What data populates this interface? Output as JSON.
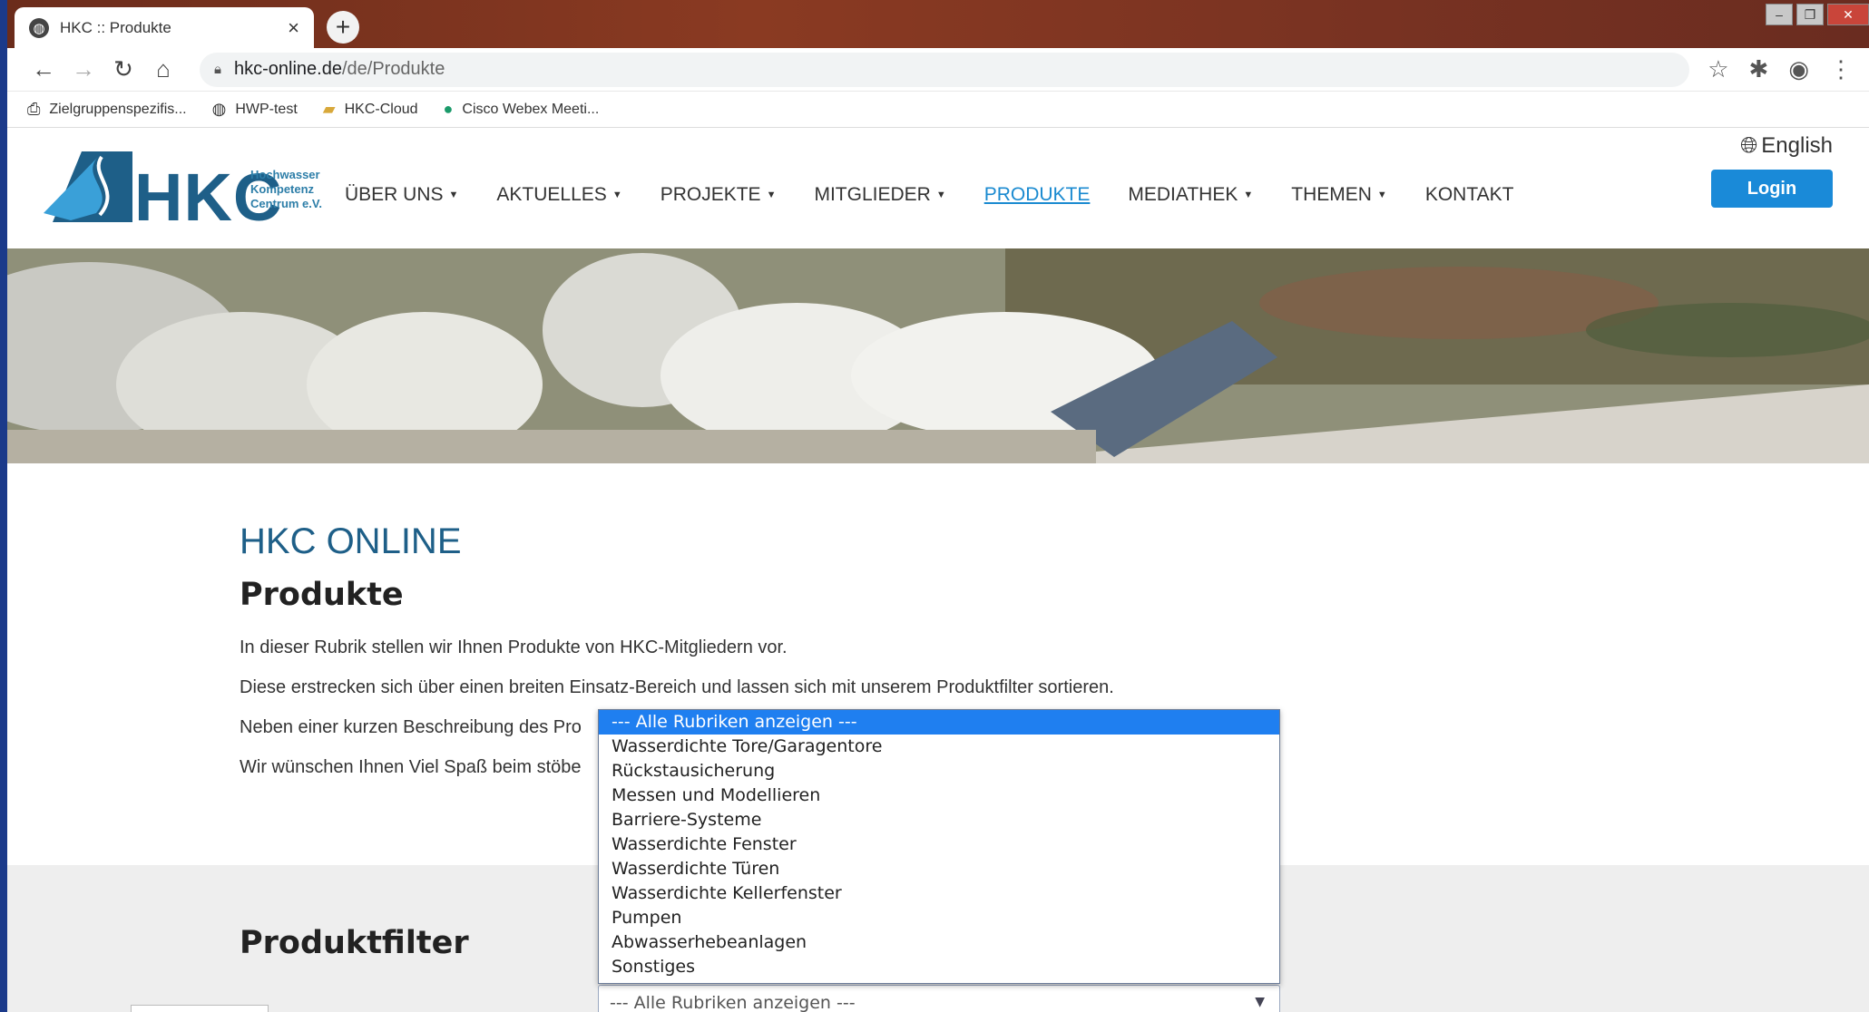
{
  "browser": {
    "tab_title": "HKC :: Produkte",
    "tab_close": "×",
    "new_tab": "+",
    "url_host": "hkc-online.de",
    "url_path": "/de/Produkte",
    "bookmarks": [
      {
        "label": "Zielgruppenspezifis..."
      },
      {
        "label": "HWP-test"
      },
      {
        "label": "HKC-Cloud"
      },
      {
        "label": "Cisco Webex Meeti..."
      }
    ]
  },
  "site": {
    "logo_text": "HKC",
    "logo_sub1": "Hochwasser",
    "logo_sub2": "Kompetenz",
    "logo_sub3": "Centrum e.V.",
    "nav": [
      {
        "label": "ÜBER UNS",
        "dropdown": true
      },
      {
        "label": "AKTUELLES",
        "dropdown": true
      },
      {
        "label": "PROJEKTE",
        "dropdown": true
      },
      {
        "label": "MITGLIEDER",
        "dropdown": true
      },
      {
        "label": "PRODUKTE",
        "dropdown": false,
        "active": true
      },
      {
        "label": "MEDIATHEK",
        "dropdown": true
      },
      {
        "label": "THEMEN",
        "dropdown": true
      },
      {
        "label": "KONTAKT",
        "dropdown": false
      }
    ],
    "language": "English",
    "login": "Login"
  },
  "content": {
    "kicker": "HKC ONLINE",
    "heading": "Produkte",
    "paragraphs": [
      "In dieser Rubrik stellen wir Ihnen Produkte von HKC-Mitgliedern vor.",
      "Diese erstrecken sich über einen breiten Einsatz-Bereich und lassen sich mit unserem Produktfilter sortieren.",
      "Neben einer kurzen Beschreibung des Pro",
      "Wir wünschen Ihnen Viel Spaß beim stöbe"
    ],
    "filter_heading": "Produktfilter"
  },
  "select": {
    "current": "--- Alle Rubriken anzeigen ---",
    "options": [
      "--- Alle Rubriken anzeigen ---",
      "Wasserdichte Tore/Garagentore",
      "Rückstausicherung",
      "Messen und Modellieren",
      "Barriere-Systeme",
      "Wasserdichte Fenster",
      "Wasserdichte Türen",
      "Wasserdichte Kellerfenster",
      "Pumpen",
      "Abwasserhebeanlagen",
      "Sonstiges"
    ]
  },
  "colors": {
    "brand_blue": "#1e5f88",
    "link_active": "#1a8ad0",
    "login_bg": "#1a8ad8",
    "option_selected_bg": "#1f7ff0"
  }
}
